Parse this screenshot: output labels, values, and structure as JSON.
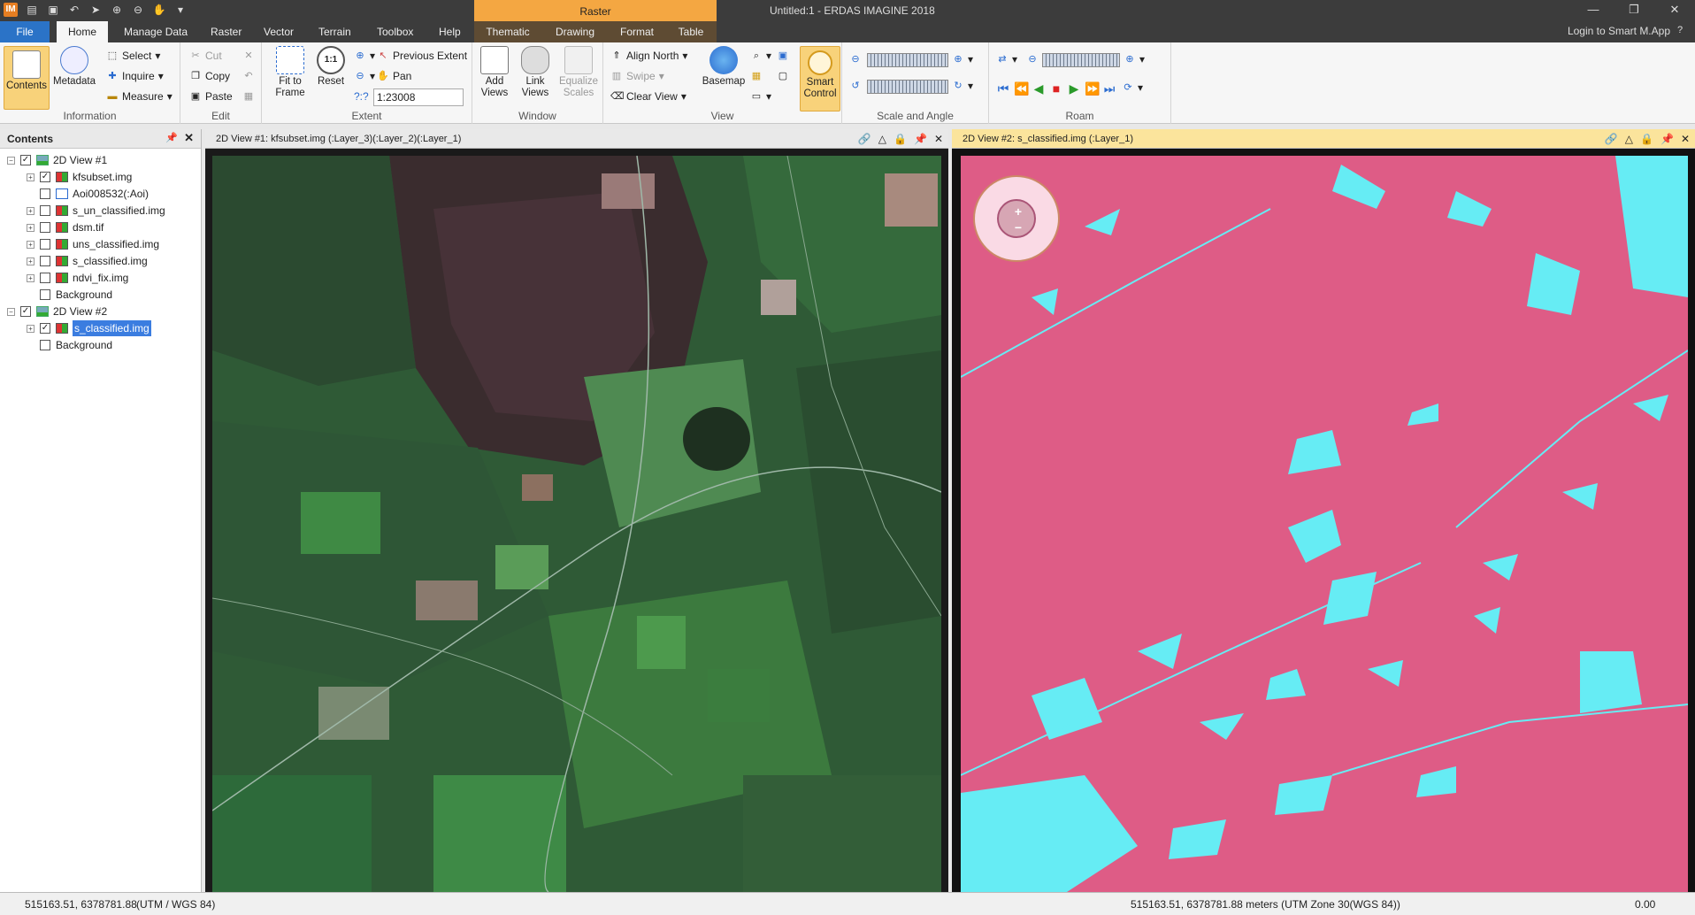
{
  "window": {
    "title": "Untitled:1 - ERDAS IMAGINE 2018",
    "context_group": "Raster"
  },
  "tabs": [
    "File",
    "Home",
    "Manage Data",
    "Raster",
    "Vector",
    "Terrain",
    "Toolbox",
    "Help",
    "Thematic",
    "Drawing",
    "Format",
    "Table"
  ],
  "login": "Login to Smart M.App",
  "ribbon": {
    "information": {
      "label": "Information",
      "contents": "Contents",
      "metadata": "Metadata",
      "select": "Select",
      "inquire": "Inquire",
      "measure": "Measure"
    },
    "edit": {
      "label": "Edit",
      "cut": "Cut",
      "copy": "Copy",
      "paste": "Paste"
    },
    "extent": {
      "label": "Extent",
      "fit_to_frame": "Fit to Frame",
      "reset": "Reset",
      "previous_extent": "Previous Extent",
      "pan": "Pan",
      "scale": "1:23008",
      "unknown": "?:?"
    },
    "window": {
      "label": "Window",
      "add_views": "Add Views",
      "link_views": "Link Views",
      "equalize_scales": "Equalize Scales"
    },
    "view": {
      "label": "View",
      "align_north": "Align North",
      "swipe": "Swipe",
      "clear_view": "Clear View",
      "basemap": "Basemap",
      "smart_control": "Smart Control"
    },
    "scale_angle": {
      "label": "Scale and Angle"
    },
    "roam": {
      "label": "Roam"
    }
  },
  "contents": {
    "title": "Contents",
    "view1": {
      "name": "2D View #1",
      "layers": [
        {
          "name": "kfsubset.img",
          "checked": true,
          "type": "raster"
        },
        {
          "name": "Aoi008532(:Aoi)",
          "checked": false,
          "type": "aoi"
        },
        {
          "name": "s_un_classified.img",
          "checked": false,
          "type": "raster"
        },
        {
          "name": "dsm.tif",
          "checked": false,
          "type": "raster"
        },
        {
          "name": "uns_classified.img",
          "checked": false,
          "type": "raster"
        },
        {
          "name": "s_classified.img",
          "checked": false,
          "type": "raster"
        },
        {
          "name": "ndvi_fix.img",
          "checked": false,
          "type": "raster"
        },
        {
          "name": "Background",
          "checked": false,
          "type": "background"
        }
      ]
    },
    "view2": {
      "name": "2D View #2",
      "layers": [
        {
          "name": "s_classified.img",
          "checked": true,
          "type": "raster",
          "selected": true
        },
        {
          "name": "Background",
          "checked": false,
          "type": "background"
        }
      ]
    }
  },
  "view1": {
    "title": "2D View #1: kfsubset.img (:Layer_3)(:Layer_2)(:Layer_1)"
  },
  "view2": {
    "title": "2D View #2: s_classified.img (:Layer_1)"
  },
  "status": {
    "left_coords": "515163.51, 6378781.88",
    "left_proj": "(UTM / WGS 84)",
    "right_coords": "515163.51, 6378781.88 meters (UTM Zone 30(WGS 84))",
    "right_value": "0.00"
  },
  "colors": {
    "classified_bg": "#de5c86",
    "classified_water": "#66ecf4",
    "accent": "#2b73c7",
    "context": "#f4a742"
  }
}
